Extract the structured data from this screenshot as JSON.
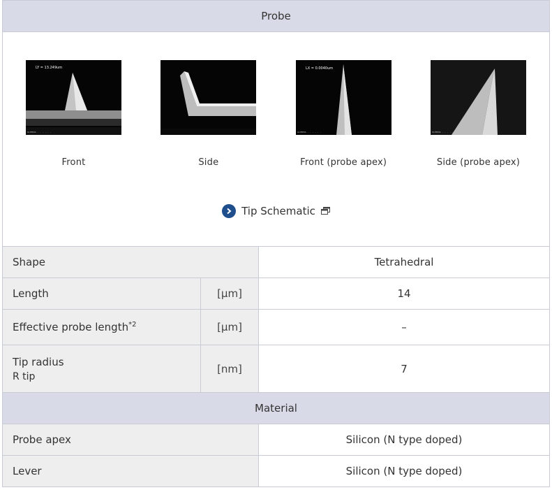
{
  "probe_header": "Probe",
  "images": [
    {
      "caption": "Front",
      "overlay_text": "LY = 13.249um"
    },
    {
      "caption": "Side",
      "overlay_text": ""
    },
    {
      "caption": "Front (probe apex)",
      "overlay_text": "LX = 0.0040um"
    },
    {
      "caption": "Side (probe apex)",
      "overlay_text": ""
    }
  ],
  "tip_schematic": {
    "label": "Tip Schematic"
  },
  "specs": {
    "shape": {
      "label": "Shape",
      "value": "Tetrahedral"
    },
    "length": {
      "label": "Length",
      "unit": "[μm]",
      "value": "14"
    },
    "effective": {
      "label": "Effective probe length",
      "sup": "*2",
      "unit": "[μm]",
      "value": "–"
    },
    "tip_radius": {
      "label": "Tip radius",
      "sublabel": "R tip",
      "unit": "[nm]",
      "value": "7"
    }
  },
  "material_header": "Material",
  "material": {
    "probe_apex": {
      "label": "Probe apex",
      "value": "Silicon (N type doped)"
    },
    "lever": {
      "label": "Lever",
      "value": "Silicon (N type doped)"
    }
  },
  "colors": {
    "header_bg": "#d8dbe7",
    "label_bg": "#eeeeee",
    "border": "#c8cbd6",
    "icon_blue": "#1e4e8c"
  }
}
